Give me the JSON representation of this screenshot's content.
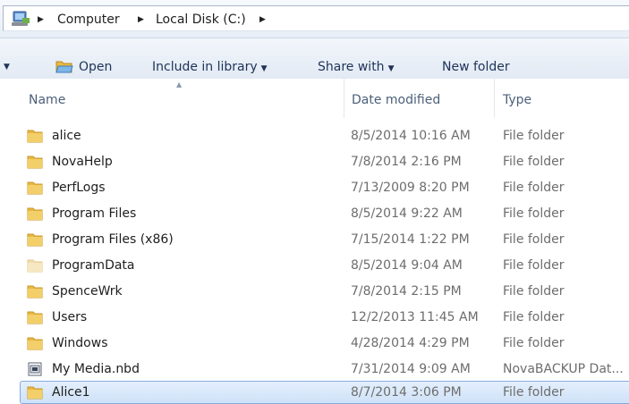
{
  "address": {
    "icon": "computer-icon",
    "crumbs": [
      "Computer",
      "Local Disk (C:)"
    ]
  },
  "toolbar": {
    "open_label": "Open",
    "include_label": "Include in library",
    "share_label": "Share with",
    "new_folder_label": "New folder"
  },
  "columns": {
    "name": "Name",
    "date": "Date modified",
    "type": "Type"
  },
  "rows": [
    {
      "name": "alice",
      "date": "8/5/2014 10:16 AM",
      "type": "File folder",
      "icon": "folder-icon"
    },
    {
      "name": "NovaHelp",
      "date": "7/8/2014 2:16 PM",
      "type": "File folder",
      "icon": "folder-icon"
    },
    {
      "name": "PerfLogs",
      "date": "7/13/2009 8:20 PM",
      "type": "File folder",
      "icon": "folder-icon"
    },
    {
      "name": "Program Files",
      "date": "8/5/2014 9:22 AM",
      "type": "File folder",
      "icon": "folder-icon"
    },
    {
      "name": "Program Files (x86)",
      "date": "7/15/2014 1:22 PM",
      "type": "File folder",
      "icon": "folder-icon"
    },
    {
      "name": "ProgramData",
      "date": "8/5/2014 9:04 AM",
      "type": "File folder",
      "icon": "folder-hidden-icon"
    },
    {
      "name": "SpenceWrk",
      "date": "7/8/2014 2:15 PM",
      "type": "File folder",
      "icon": "folder-icon"
    },
    {
      "name": "Users",
      "date": "12/2/2013 11:45 AM",
      "type": "File folder",
      "icon": "folder-icon"
    },
    {
      "name": "Windows",
      "date": "4/28/2014 4:29 PM",
      "type": "File folder",
      "icon": "folder-icon"
    },
    {
      "name": "My Media.nbd",
      "date": "7/31/2014 9:09 AM",
      "type": "NovaBACKUP Dat...",
      "icon": "backup-file-icon"
    },
    {
      "name": "Alice1",
      "date": "8/7/2014 3:06 PM",
      "type": "File folder",
      "icon": "folder-icon",
      "selected": true
    }
  ],
  "colors": {
    "folder": "#e8b941",
    "selection": "#cfe2f8",
    "toolbar_text": "#1e3358"
  }
}
